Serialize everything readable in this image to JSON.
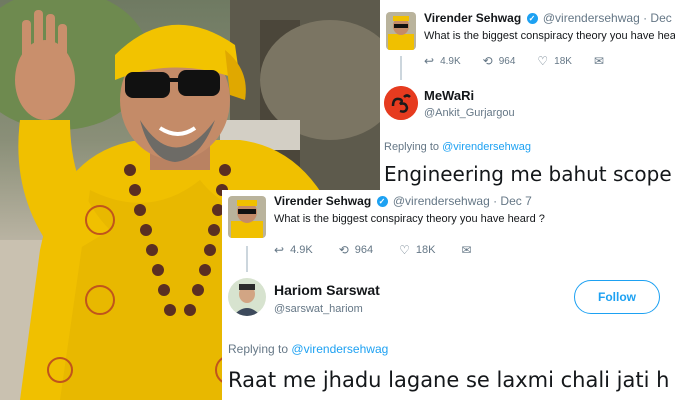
{
  "tweet1": {
    "author_name": "Virender Sehwag",
    "author_handle": "@virendersehwag",
    "date": "· Dec 7",
    "text": "What is the biggest conspiracy theory you have heard ?",
    "replies": "4.9K",
    "retweets": "964",
    "likes": "18K",
    "reply_author_name": "MeWaRi",
    "reply_author_handle": "@Ankit_Gurjargou",
    "replying_to_prefix": "Replying to",
    "replying_to_handle": "@virendersehwag",
    "reply_text": "Engineering me bahut scope h"
  },
  "tweet2": {
    "author_name": "Virender Sehwag",
    "author_handle": "@virendersehwag",
    "date": "· Dec 7",
    "text": "What is the biggest conspiracy theory you have heard ?",
    "replies": "4.9K",
    "retweets": "964",
    "likes": "18K",
    "reply_author_name": "Hariom Sarswat",
    "reply_author_handle": "@sarswat_hariom",
    "follow_label": "Follow",
    "replying_to_prefix": "Replying to",
    "replying_to_handle": "@virendersehwag",
    "reply_text": "Raat me jhadu lagane se laxmi chali jati h",
    "reply_emoji": "😂"
  },
  "icons": {
    "reply": "↩",
    "retweet": "⟲",
    "like": "♡",
    "message": "✉",
    "verified": "✓"
  },
  "colors": {
    "accent": "#1da1f2",
    "muted": "#657786",
    "robe": "#f2c300",
    "om_logo": "#e63b1f"
  }
}
